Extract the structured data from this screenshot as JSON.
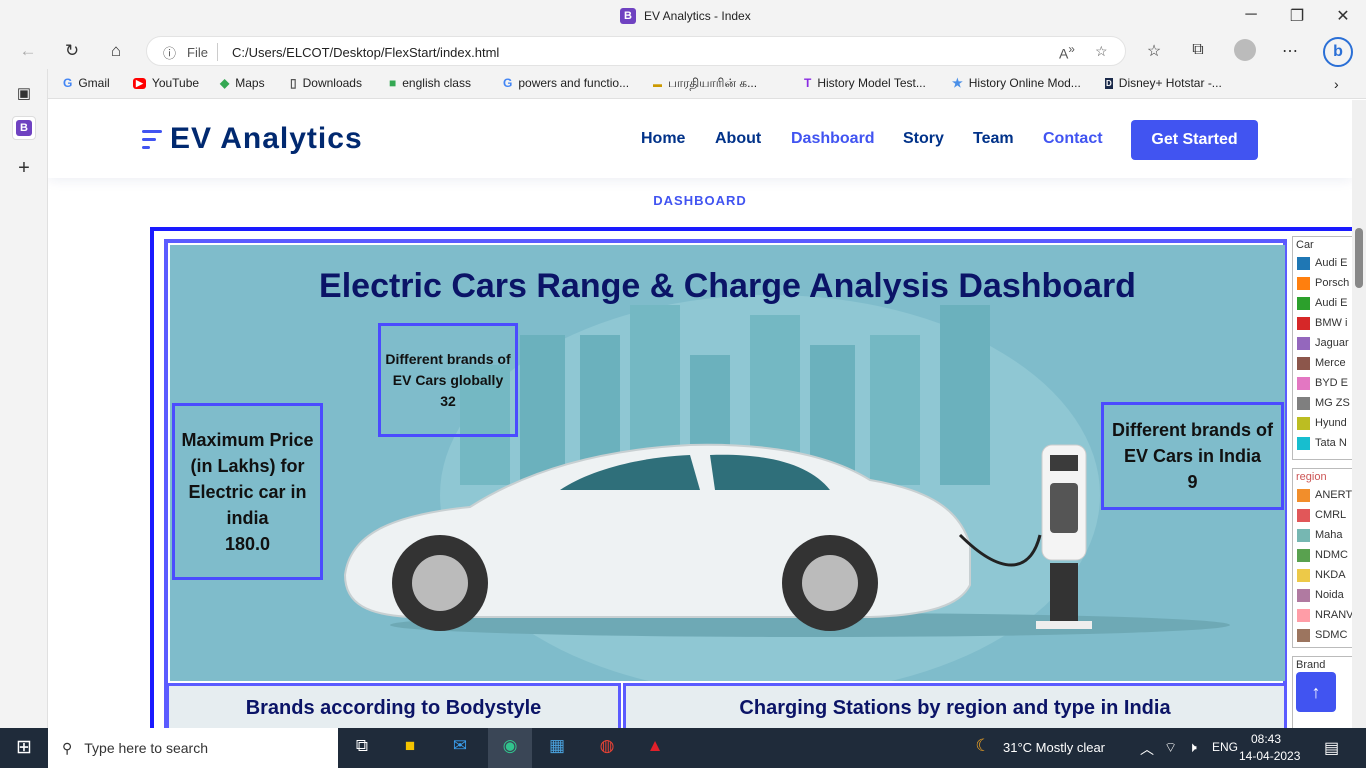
{
  "browser": {
    "tab_title": "EV Analytics - Index",
    "favicon_letter": "B",
    "address_label": "File",
    "url": "C:/Users/ELCOT/Desktop/FlexStart/index.html",
    "bing_letter": "b",
    "bookmarks": [
      "Gmail",
      "YouTube",
      "Maps",
      "Downloads",
      "english class",
      "powers and functio...",
      "பாரதியாரின் க...",
      "History Model Test...",
      "History Online Mod...",
      "Disney+ Hotstar -..."
    ]
  },
  "site": {
    "logo": "EV Analytics",
    "nav": [
      "Home",
      "About",
      "Dashboard",
      "Story",
      "Team",
      "Contact"
    ],
    "cta": "Get Started",
    "section_label": "DASHBOARD"
  },
  "dashboard": {
    "title": "Electric Cars Range & Charge Analysis Dashboard",
    "cards": {
      "global_brands_label": "Different brands of EV Cars globally",
      "global_brands_value": "32",
      "max_price_label": "Maximum Price (in Lakhs) for Electric car in india",
      "max_price_value": "180.0",
      "india_brands_label": "Different brands of EV Cars in India",
      "india_brands_value": "9"
    },
    "bottom_titles": [
      "Brands according to Bodystyle",
      "Charging Stations by region and type in India"
    ],
    "legend_car": {
      "header": "Car",
      "items": [
        {
          "label": "Audi E",
          "color": "#1f77b4"
        },
        {
          "label": "Porsch",
          "color": "#ff7f0e"
        },
        {
          "label": "Audi E",
          "color": "#2ca02c"
        },
        {
          "label": "BMW i",
          "color": "#d62728"
        },
        {
          "label": "Jaguar",
          "color": "#9467bd"
        },
        {
          "label": "Merce",
          "color": "#8c564b"
        },
        {
          "label": "BYD E",
          "color": "#e377c2"
        },
        {
          "label": "MG ZS",
          "color": "#7f7f7f"
        },
        {
          "label": "Hyund",
          "color": "#bcbd22"
        },
        {
          "label": "Tata N",
          "color": "#17becf"
        }
      ]
    },
    "legend_region": {
      "header": "region",
      "items": [
        {
          "label": "ANERT",
          "color": "#f28e2b"
        },
        {
          "label": "CMRL",
          "color": "#e15759"
        },
        {
          "label": "Maha",
          "color": "#76b7b2"
        },
        {
          "label": "NDMC",
          "color": "#59a14f"
        },
        {
          "label": "NKDA",
          "color": "#edc948"
        },
        {
          "label": "Noida",
          "color": "#b07aa1"
        },
        {
          "label": "NRANV",
          "color": "#ff9da7"
        },
        {
          "label": "SDMC",
          "color": "#9c755f"
        }
      ]
    },
    "legend_brand": {
      "header": "Brand"
    }
  },
  "taskbar": {
    "search_placeholder": "Type here to search",
    "weather": "31°C  Mostly clear",
    "lang": "ENG",
    "time": "08:43",
    "date": "14-04-2023"
  }
}
